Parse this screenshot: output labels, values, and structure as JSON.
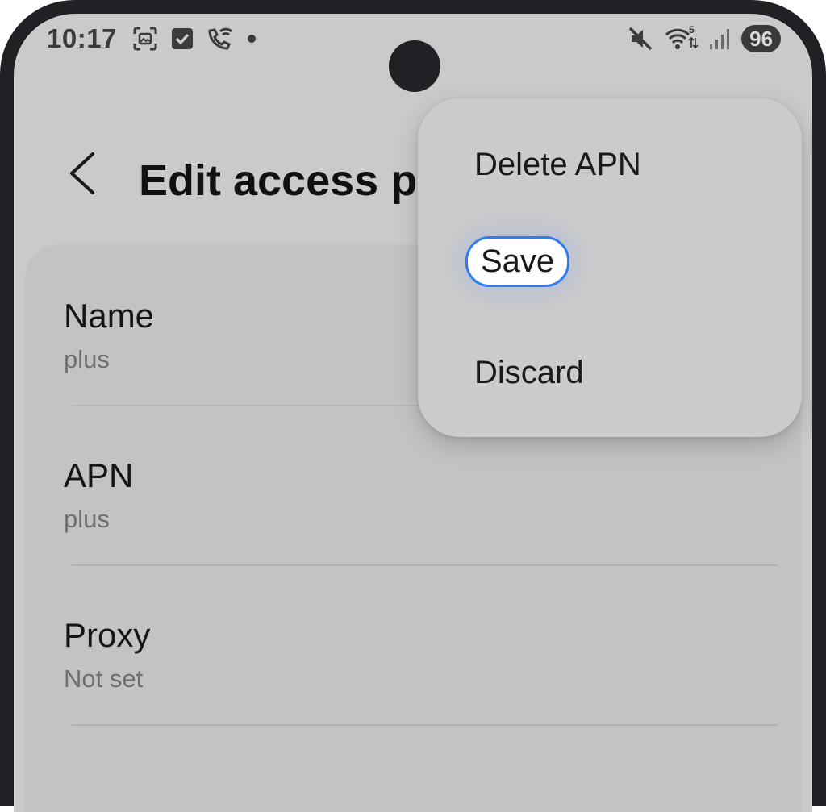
{
  "status_bar": {
    "time": "10:17",
    "left_icons": [
      "screenshot-icon",
      "checkbox-icon",
      "wifi-calling-icon",
      "dot-icon"
    ],
    "right_icons": [
      "mute-icon",
      "wifi-5-icon",
      "signal-icon"
    ],
    "battery": "96"
  },
  "header": {
    "back_icon": "chevron-left-icon",
    "title": "Edit access p"
  },
  "settings": [
    {
      "label": "Name",
      "value": "plus"
    },
    {
      "label": "APN",
      "value": "plus"
    },
    {
      "label": "Proxy",
      "value": "Not set"
    }
  ],
  "menu": {
    "items": [
      "Delete APN",
      "Save",
      "Discard"
    ],
    "highlight_color": "#2f7bf0"
  },
  "colors": {
    "background": "#cacaca",
    "card": "#c3c3c3",
    "frame": "#1f2124"
  }
}
